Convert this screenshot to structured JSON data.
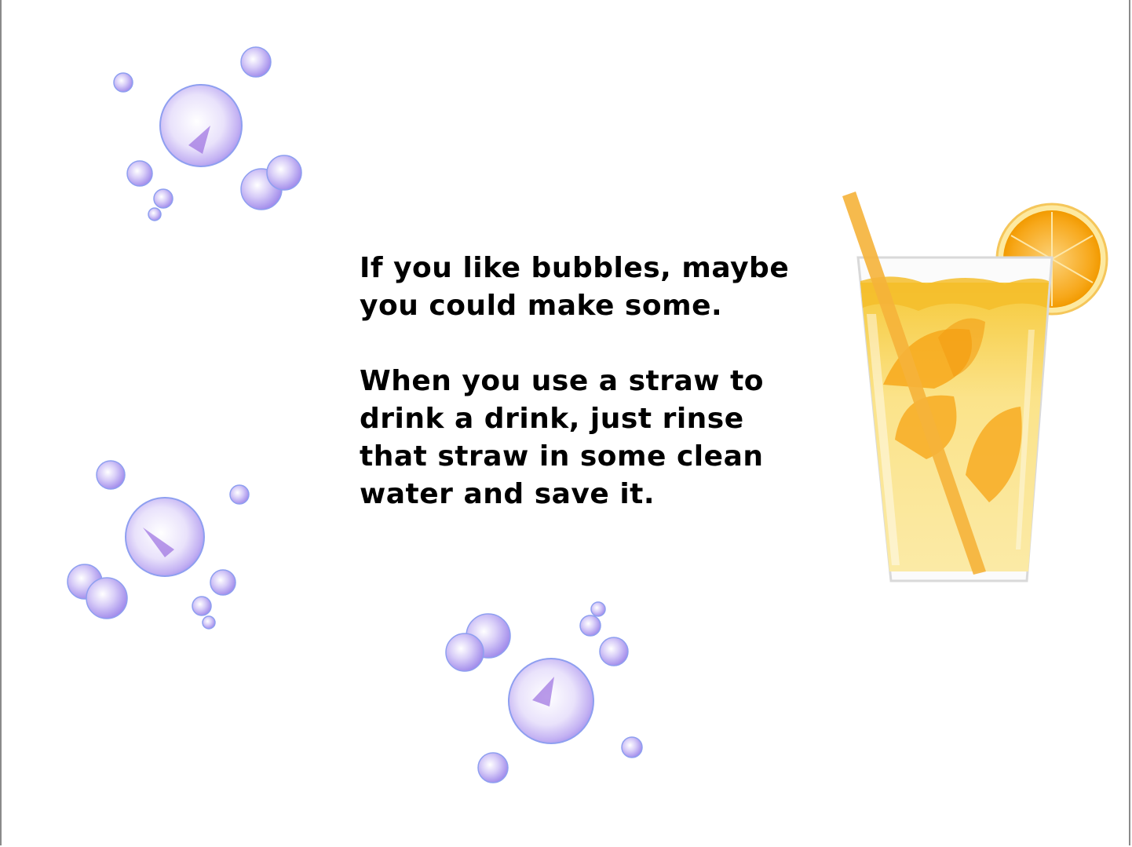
{
  "page": {
    "paragraph_1": "If you like bubbles, maybe\nyou could make some.",
    "paragraph_2": "When you use a straw to\ndrink a drink, just rinse\nthat straw in some clean\nwater and save it."
  },
  "illustrations": {
    "bubble_color": "#b9a6f2",
    "bubble_outline": "#7f8fe6",
    "glass_juice_color": "#f8d85a",
    "orange_color": "#f7a81b",
    "straw_color": "#f5b23a"
  }
}
